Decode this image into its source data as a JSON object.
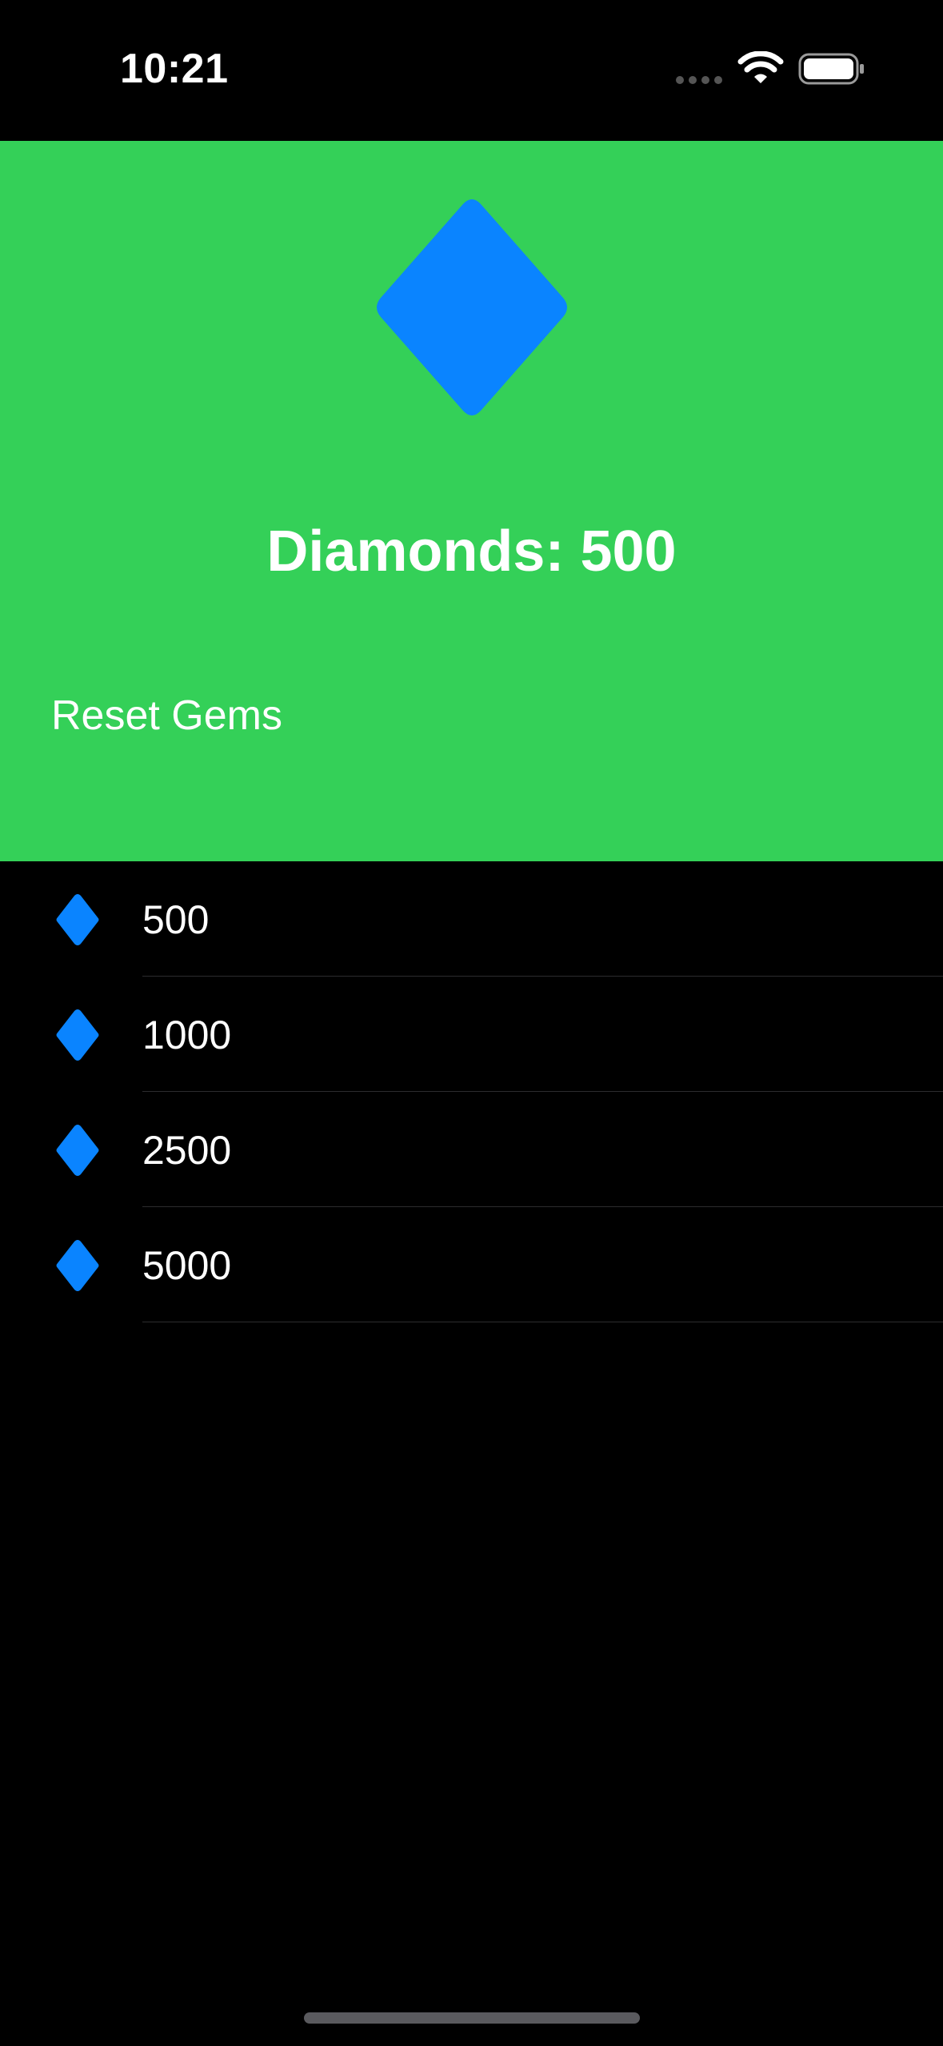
{
  "status_bar": {
    "time": "10:21"
  },
  "header": {
    "background_color": "#34d058",
    "diamond_color": "#0a84ff",
    "count_label": "Diamonds: ",
    "count_value": "500",
    "reset_label": "Reset Gems"
  },
  "packages": [
    {
      "icon": "diamond-icon",
      "label": "500"
    },
    {
      "icon": "diamond-icon",
      "label": "1000"
    },
    {
      "icon": "diamond-icon",
      "label": "2500"
    },
    {
      "icon": "diamond-icon",
      "label": "5000"
    }
  ]
}
